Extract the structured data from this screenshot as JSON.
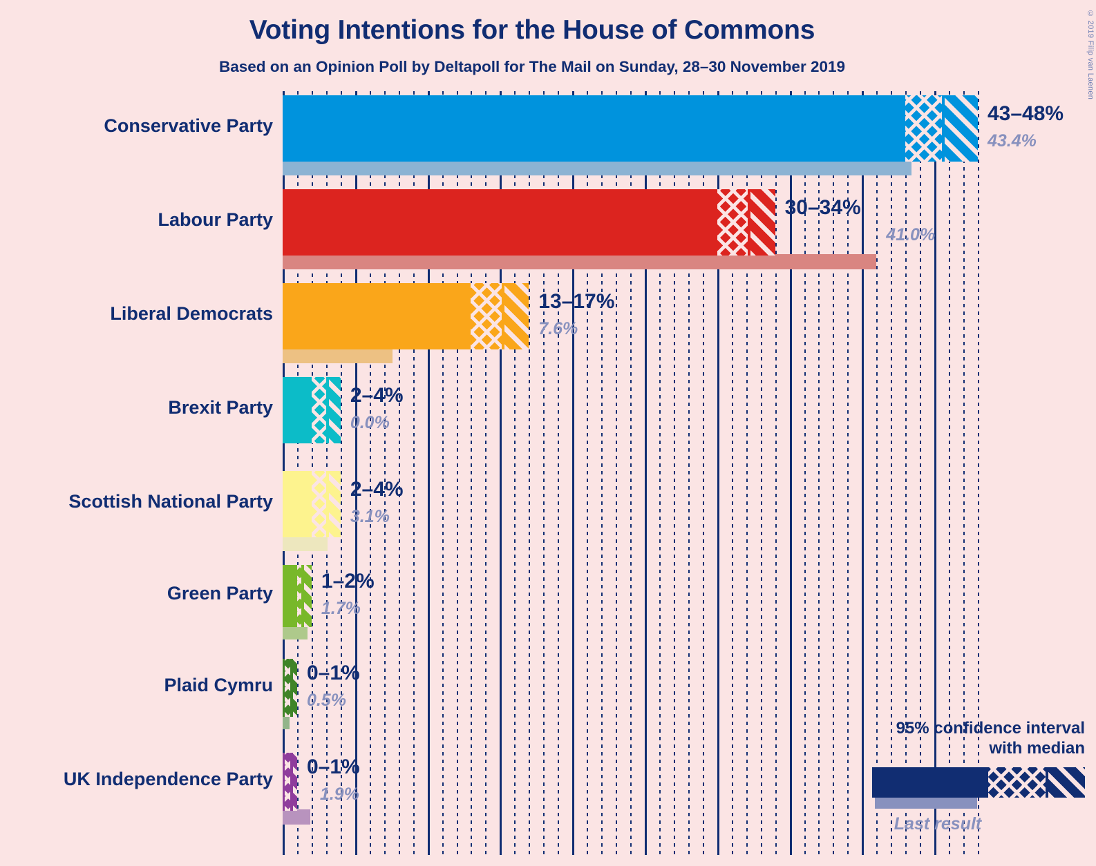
{
  "header": {
    "title": "Voting Intentions for the House of Commons",
    "subtitle": "Based on an Opinion Poll by Deltapoll for The Mail on Sunday, 28–30 November 2019",
    "copyright": "© 2019 Filip van Laenen"
  },
  "legend": {
    "line1": "95% confidence interval",
    "line2": "with median",
    "caption": "Last result",
    "ci_color": "#112D72",
    "last_color": "#8891BE"
  },
  "chart_data": {
    "type": "bar",
    "title": "Voting Intentions for the House of Commons",
    "subtitle": "Based on an Opinion Poll by Deltapoll for The Mail on Sunday, 28–30 November 2019",
    "xlabel": "",
    "ylabel": "",
    "xlim": [
      0,
      48.5
    ],
    "grid": true,
    "grid_major_step": 5,
    "grid_minor_step": 1,
    "legend_position": "bottom-right",
    "categories": [
      "Conservative Party",
      "Labour Party",
      "Liberal Democrats",
      "Brexit Party",
      "Scottish National Party",
      "Green Party",
      "Plaid Cymru",
      "UK Independence Party"
    ],
    "series": [
      {
        "name": "95% confidence interval low",
        "values": [
          43,
          30,
          13,
          2,
          2,
          1,
          0,
          0
        ]
      },
      {
        "name": "95% confidence interval high",
        "values": [
          48,
          34,
          17,
          4,
          4,
          2,
          1,
          1
        ]
      },
      {
        "name": "Last result",
        "values": [
          43.4,
          41.0,
          7.6,
          0.0,
          3.1,
          1.7,
          0.5,
          1.9
        ]
      }
    ],
    "annotations": [
      "43–48%",
      "30–34%",
      "13–17%",
      "2–4%",
      "2–4%",
      "1–2%",
      "0–1%",
      "0–1%"
    ]
  },
  "rows": [
    {
      "label": "Conservative Party",
      "range_label": "43–48%",
      "last_label": "43.4%",
      "ci_low": 43,
      "ci_high": 48,
      "median": 45.6,
      "last": 43.4,
      "color": "#0093DD",
      "last_color": "#8CB3D3"
    },
    {
      "label": "Labour Party",
      "range_label": "30–34%",
      "last_label": "41.0%",
      "ci_low": 30,
      "ci_high": 34,
      "median": 32.2,
      "last": 41.0,
      "color": "#DC241F",
      "last_color": "#D98581"
    },
    {
      "label": "Liberal Democrats",
      "range_label": "13–17%",
      "last_label": "7.6%",
      "ci_low": 13,
      "ci_high": 17,
      "median": 15.2,
      "last": 7.6,
      "color": "#FAA61A",
      "last_color": "#EDC183"
    },
    {
      "label": "Brexit Party",
      "range_label": "2–4%",
      "last_label": "0.0%",
      "ci_low": 2,
      "ci_high": 4,
      "median": 3.1,
      "last": 0.0,
      "color": "#0CBCC8",
      "last_color": "#90D6DA"
    },
    {
      "label": "Scottish National Party",
      "range_label": "2–4%",
      "last_label": "3.1%",
      "ci_low": 2,
      "ci_high": 4,
      "median": 3.1,
      "last": 3.1,
      "color": "#FDF38E",
      "last_color": "#EDE7BE"
    },
    {
      "label": "Green Party",
      "range_label": "1–2%",
      "last_label": "1.7%",
      "ci_low": 1,
      "ci_high": 2,
      "median": 1.4,
      "last": 1.7,
      "color": "#78B82A",
      "last_color": "#AEC98B"
    },
    {
      "label": "Plaid Cymru",
      "range_label": "0–1%",
      "last_label": "0.5%",
      "ci_low": 0.15,
      "ci_high": 1.0,
      "median": 0.6,
      "last": 0.5,
      "color": "#3F8428",
      "last_color": "#93B58A"
    },
    {
      "label": "UK Independence Party",
      "range_label": "0–1%",
      "last_label": "1.9%",
      "ci_low": 0.15,
      "ci_high": 1.0,
      "median": 0.6,
      "last": 1.9,
      "color": "#8F3C9C",
      "last_color": "#B893BE"
    }
  ]
}
